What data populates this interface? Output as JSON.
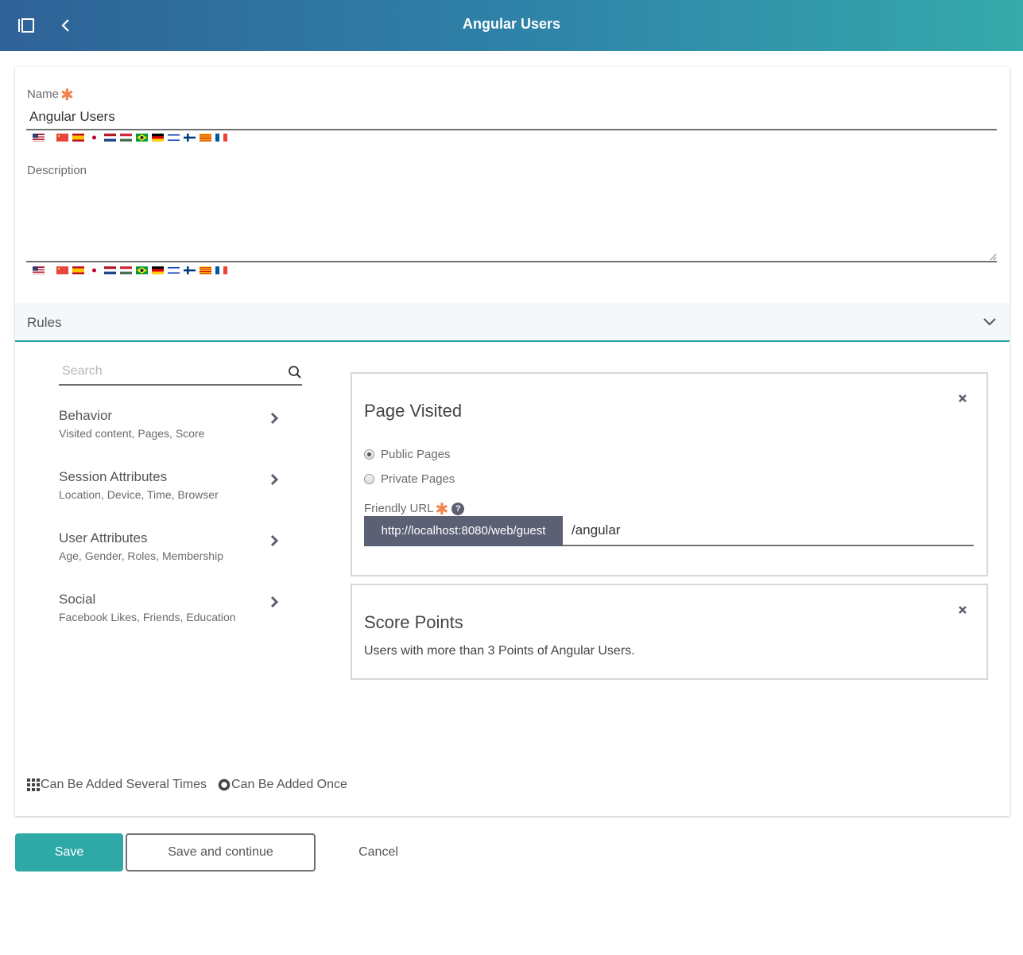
{
  "header": {
    "title": "Angular Users",
    "sidebar_icon": "sidebar-toggle-icon",
    "back_icon": "chevron-left-icon"
  },
  "form": {
    "name_label": "Name",
    "required_mark": "✱",
    "name_value": "Angular Users",
    "description_label": "Description",
    "description_value": "",
    "locale_flags": [
      "en-US",
      "zh-CN",
      "es-ES",
      "ja-JP",
      "nl-NL",
      "hu-HU",
      "pt-BR",
      "de-DE",
      "iw-IL",
      "fi-FI",
      "ca-ES",
      "fr-FR"
    ]
  },
  "rules": {
    "title": "Rules",
    "search_placeholder": "Search",
    "categories": [
      {
        "name": "Behavior",
        "description": "Visited content, Pages, Score"
      },
      {
        "name": "Session Attributes",
        "description": "Location, Device, Time, Browser"
      },
      {
        "name": "User Attributes",
        "description": "Age, Gender, Roles, Membership"
      },
      {
        "name": "Social",
        "description": "Facebook Likes, Friends, Education"
      }
    ],
    "page_visited": {
      "title": "Page Visited",
      "options": [
        "Public Pages",
        "Private Pages"
      ],
      "selected": "Public Pages",
      "friendly_url_label": "Friendly URL",
      "help": "?",
      "url_prefix": "http://localhost:8080/web/guest",
      "url_value": "/angular"
    },
    "score_points": {
      "title": "Score Points",
      "description": "Users with more than 3 Points of Angular Users."
    },
    "legend": {
      "several_times": "Can Be Added Several Times",
      "once": "Can Be Added Once"
    }
  },
  "actions": {
    "save": "Save",
    "save_continue": "Save and continue",
    "cancel": "Cancel"
  },
  "colors": {
    "accent": "#2fa8a8",
    "required": "#f0824a",
    "url_prefix_bg": "#5b6075"
  }
}
